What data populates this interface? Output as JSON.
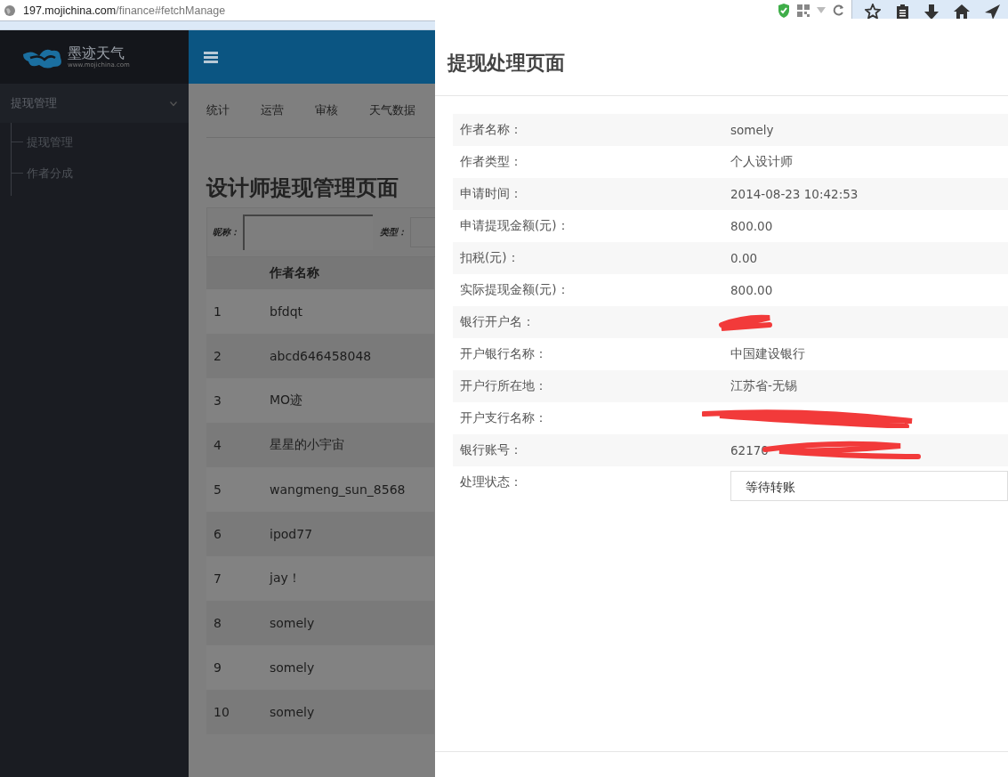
{
  "browser": {
    "url_host": "197.mojichina.com",
    "url_path": "/finance#fetchManage"
  },
  "logo": {
    "name": "墨迹天气",
    "site": "www.mojichina.com"
  },
  "sidebar": {
    "items": [
      {
        "label": "提现管理",
        "expanded": true,
        "children": [
          {
            "label": "提现管理"
          },
          {
            "label": "作者分成"
          }
        ]
      }
    ]
  },
  "top_tabs": [
    "统计",
    "运营",
    "审核",
    "天气数据"
  ],
  "page_title": "设计师提现管理页面",
  "filter": {
    "nickname_label": "昵称：",
    "type_label": "类型："
  },
  "table": {
    "columns": [
      "作者名称"
    ],
    "rows": [
      {
        "index": "1",
        "name": "bfdqt"
      },
      {
        "index": "2",
        "name": "abcd646458048"
      },
      {
        "index": "3",
        "name": "MO迹"
      },
      {
        "index": "4",
        "name": "星星的小宇宙"
      },
      {
        "index": "5",
        "name": "wangmeng_sun_8568"
      },
      {
        "index": "6",
        "name": "ipod77"
      },
      {
        "index": "7",
        "name": "jay！"
      },
      {
        "index": "8",
        "name": "somely"
      },
      {
        "index": "9",
        "name": "somely"
      },
      {
        "index": "10",
        "name": "somely"
      }
    ]
  },
  "dialog": {
    "title": "提现处理页面",
    "fields": [
      {
        "kind": "text",
        "label": "作者名称：",
        "value": "somely"
      },
      {
        "kind": "text",
        "label": "作者类型：",
        "value": "个人设计师"
      },
      {
        "kind": "text",
        "label": "申请时间：",
        "value": "2014-08-23 10:42:53"
      },
      {
        "kind": "text",
        "label": "申请提现金额(元)：",
        "value": "800.00"
      },
      {
        "kind": "text",
        "label": "扣税(元)：",
        "value": "0.00"
      },
      {
        "kind": "text",
        "label": "实际提现金额(元)：",
        "value": "800.00"
      },
      {
        "kind": "redacted",
        "label": "银行开户名："
      },
      {
        "kind": "text",
        "label": "开户银行名称：",
        "value": "中国建设银行"
      },
      {
        "kind": "text",
        "label": "开户行所在地：",
        "value": "江苏省-无锡"
      },
      {
        "kind": "redacted",
        "label": "开户支行名称："
      },
      {
        "kind": "partly_redacted",
        "label": "银行账号：",
        "value": "62170"
      },
      {
        "kind": "select",
        "label": "处理状态：",
        "value": "等待转账"
      }
    ]
  }
}
